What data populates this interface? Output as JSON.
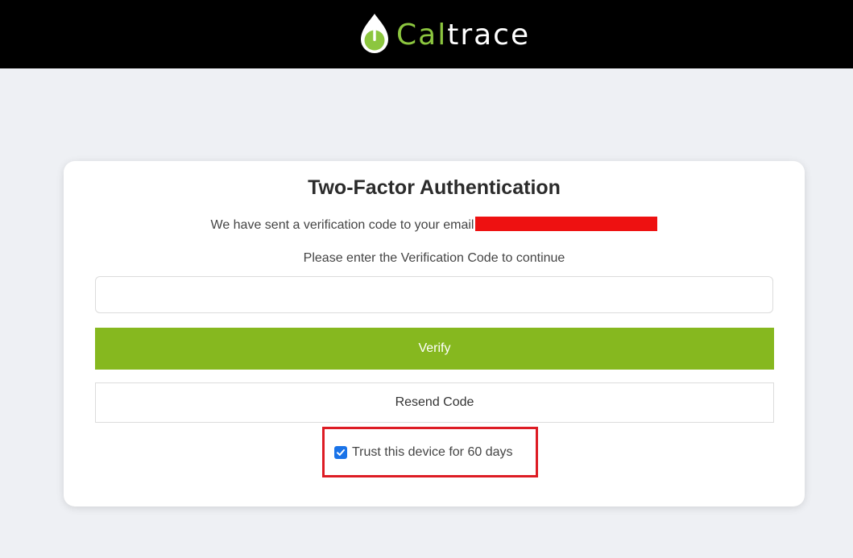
{
  "header": {
    "brand_part1": "Cal",
    "brand_part2": "trace",
    "brand_color": "#8cc63f"
  },
  "card": {
    "title": "Two-Factor Authentication",
    "sent_message": "We have sent a verification code to your email",
    "instruction": "Please enter the Verification Code to continue",
    "code_input": {
      "value": "",
      "placeholder": ""
    },
    "verify_label": "Verify",
    "resend_label": "Resend Code",
    "trust_label": "Trust this device for 60 days",
    "trust_checked": true,
    "colors": {
      "verify_bg": "#86b81f",
      "highlight_border": "#dd1c24",
      "checkbox": "#1a73e8"
    }
  }
}
